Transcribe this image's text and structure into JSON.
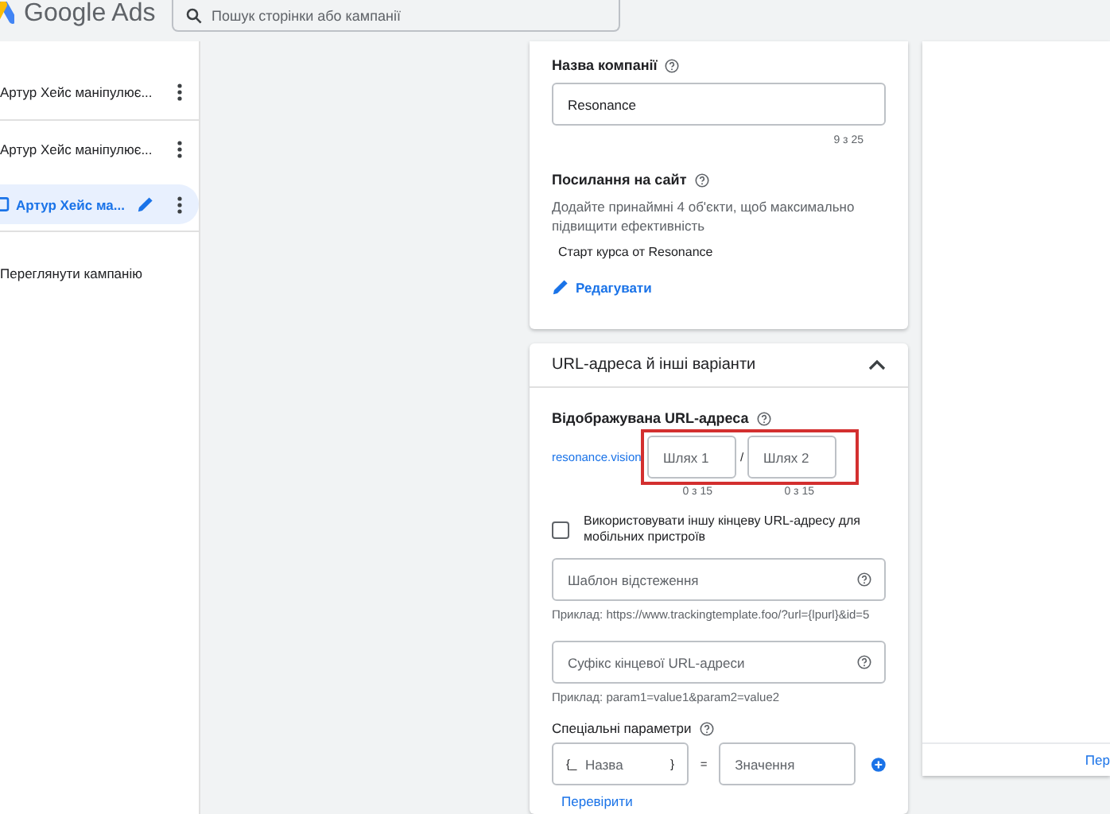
{
  "header": {
    "logo_text": "Google Ads",
    "search": {
      "placeholder": "Пошук сторінки або кампанії"
    }
  },
  "sidebar": {
    "items": [
      {
        "label": "Артур Хейс маніпулює...",
        "kind": "campaign",
        "selected": false
      },
      {
        "label": "Артур Хейс маніпулює...",
        "kind": "campaign",
        "selected": false
      },
      {
        "label": "Артур Хейс ма...",
        "kind": "campaign",
        "selected": true
      },
      {
        "label": "Переглянути кампанію",
        "kind": "link",
        "selected": false
      }
    ]
  },
  "campaign_card": {
    "name_label": "Назва компанії",
    "name_value": "Resonance",
    "name_counter": "9 з 25",
    "sitelinks_label": "Посилання на сайт",
    "sitelinks_hint": "Додайте принаймні 4 об'єкти, щоб максимально підвищити ефективність",
    "sitelink": "Старт курса от Resonance",
    "edit_link": "Редагувати"
  },
  "url_card": {
    "title": "URL-адреса й інші варіанти",
    "expanded": true,
    "display_url_label": "Відображувана URL-адреса",
    "domain": "resonance.vision",
    "separator": "/",
    "paths": [
      {
        "placeholder": "Шлях 1",
        "counter": "0 з 15"
      },
      {
        "placeholder": "Шлях 2",
        "counter": "0 з 15"
      }
    ],
    "mobile_checkbox": {
      "label": "Використовувати іншу кінцеву URL-адресу для мобільних пристроїв",
      "checked": false
    },
    "tracking": {
      "placeholder": "Шаблон відстеження",
      "example": "Приклад: https://www.trackingtemplate.foo/?url={lpurl}&id=5"
    },
    "suffix": {
      "placeholder": "Суфікс кінцевої URL-адреси",
      "example": "Приклад: param1=value1&param2=value2"
    },
    "custom_params": {
      "label": "Спеціальні параметри",
      "name_prefix": "{_",
      "name_placeholder": "Назва",
      "name_suffix": "}",
      "equals": "=",
      "value_placeholder": "Значення"
    },
    "check_link": "Перевірити"
  },
  "right_panel": {
    "footer_link": "Пер"
  }
}
